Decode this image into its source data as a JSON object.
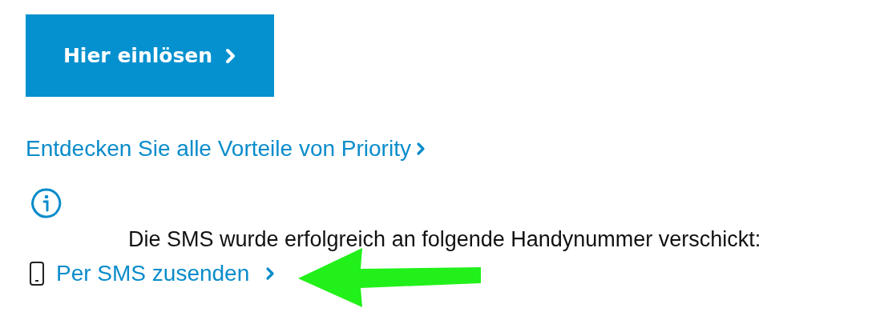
{
  "redeem_button": {
    "label": "Hier einlösen"
  },
  "benefits_link": {
    "label": "Entdecken Sie alle Vorteile von Priority"
  },
  "info_message": {
    "text": "Die SMS wurde erfolgreich an folgende Handynummer verschickt:"
  },
  "sms_link": {
    "label": "Per SMS zusenden"
  }
}
